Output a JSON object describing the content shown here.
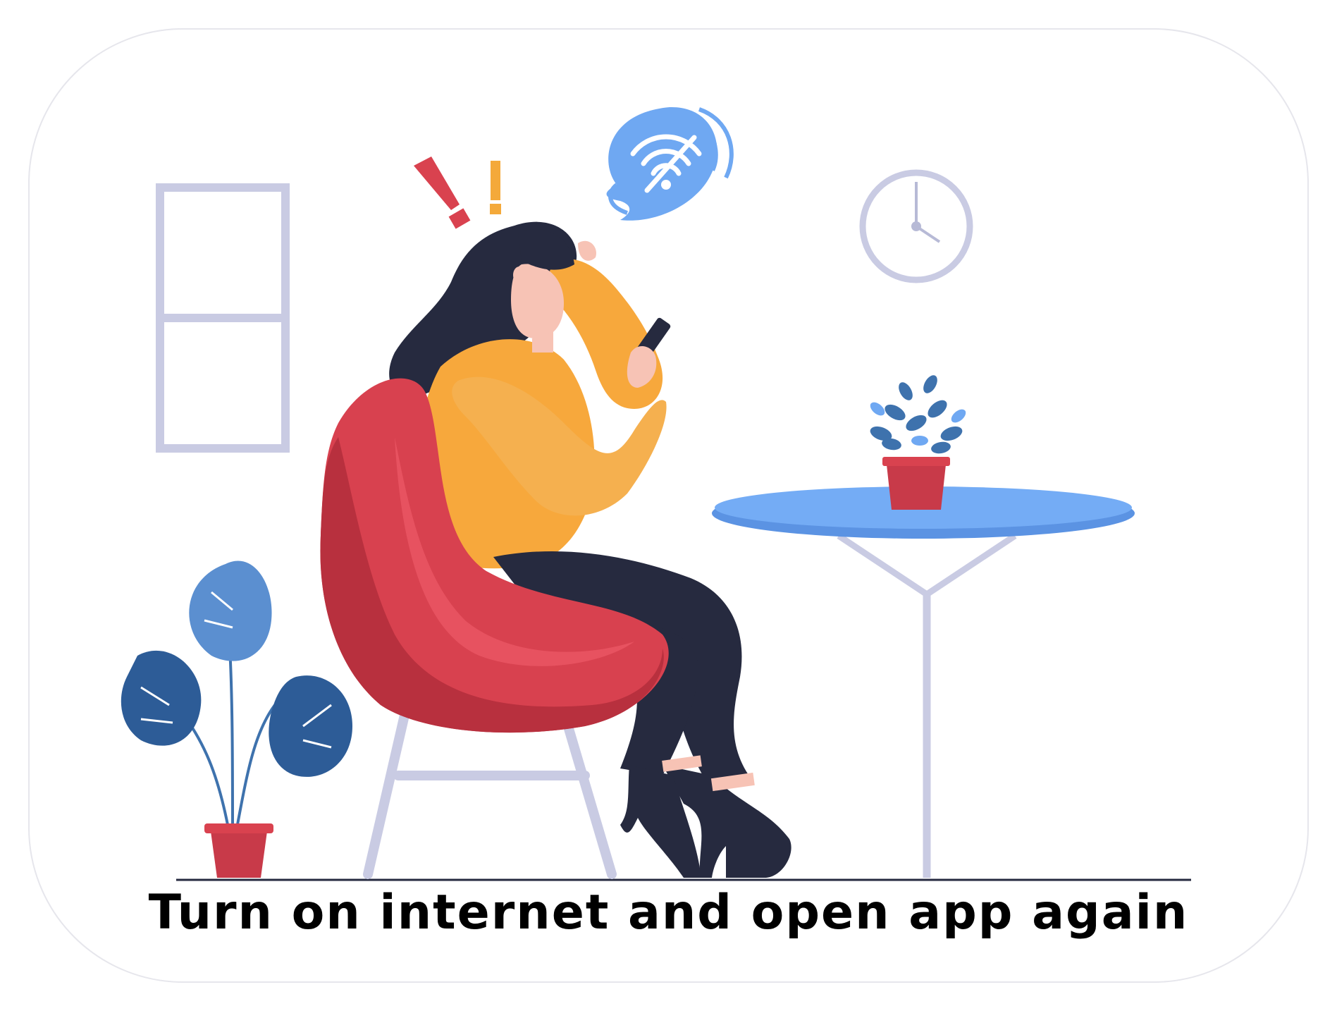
{
  "screen": {
    "message": "Turn on internet and open app again"
  },
  "illustration": {
    "icons": [
      "no-wifi-icon",
      "exclamation-icon",
      "clock-icon",
      "phone-icon"
    ],
    "colors": {
      "window_frame": "#c9cbe3",
      "wifi_bubble": "#6fa8f2",
      "exclamation_red": "#d9424f",
      "exclamation_orange": "#f4a93a",
      "clock": "#c9cbe3",
      "chair": "#d8414f",
      "sweater": "#f7a83c",
      "hair": "#262a3f",
      "table_top": "#74acf5",
      "plant_blue": "#3e72ad",
      "pot": "#c83a49"
    }
  }
}
